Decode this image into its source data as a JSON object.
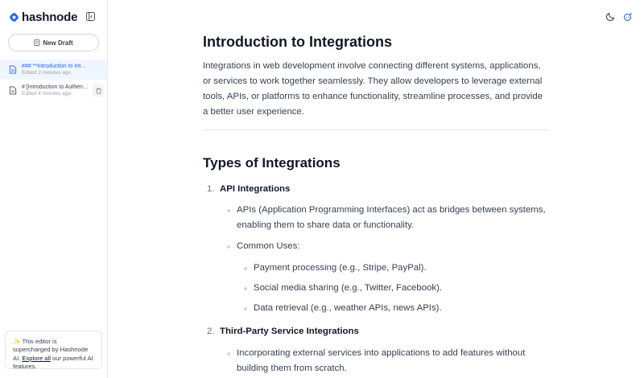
{
  "brand": {
    "name": "hashnode",
    "color": "#2962ff"
  },
  "sidebar": {
    "new_draft_label": "New Draft",
    "drafts": [
      {
        "title": "### **Introduction to Integrations**",
        "time": "Edited 2 minutes ago",
        "active": true
      },
      {
        "title": "# [Introduction to Authentication]",
        "time": "Edited 4 minutes ago",
        "active": false
      }
    ],
    "ai_note": {
      "emoji": "✨",
      "text_before": "This editor is supercharged by Hashnode AI.",
      "link": "Explore all",
      "text_after": "our powerful AI features."
    }
  },
  "topbar": {
    "icons": [
      "moon-icon",
      "ai-sparkle-icon"
    ]
  },
  "article": {
    "title": "Introduction to Integrations",
    "intro": "Integrations in web development involve connecting different systems, applications, or services to work together seamlessly. They allow developers to leverage external tools, APIs, or platforms to enhance functionality, streamline processes, and provide a better user experience.",
    "section_title": "Types of Integrations",
    "items": [
      {
        "number": "1.",
        "heading": "API Integrations",
        "desc": "APIs (Application Programming Interfaces) act as bridges between systems, enabling them to share data or functionality.",
        "common_uses_label": "Common Uses:",
        "uses": [
          "Payment processing (e.g., Stripe, PayPal).",
          "Social media sharing (e.g., Twitter, Facebook).",
          "Data retrieval (e.g., weather APIs, news APIs)."
        ]
      },
      {
        "number": "2.",
        "heading": "Third-Party Service Integrations",
        "desc": "Incorporating external services into applications to add features without building them from scratch."
      }
    ]
  }
}
